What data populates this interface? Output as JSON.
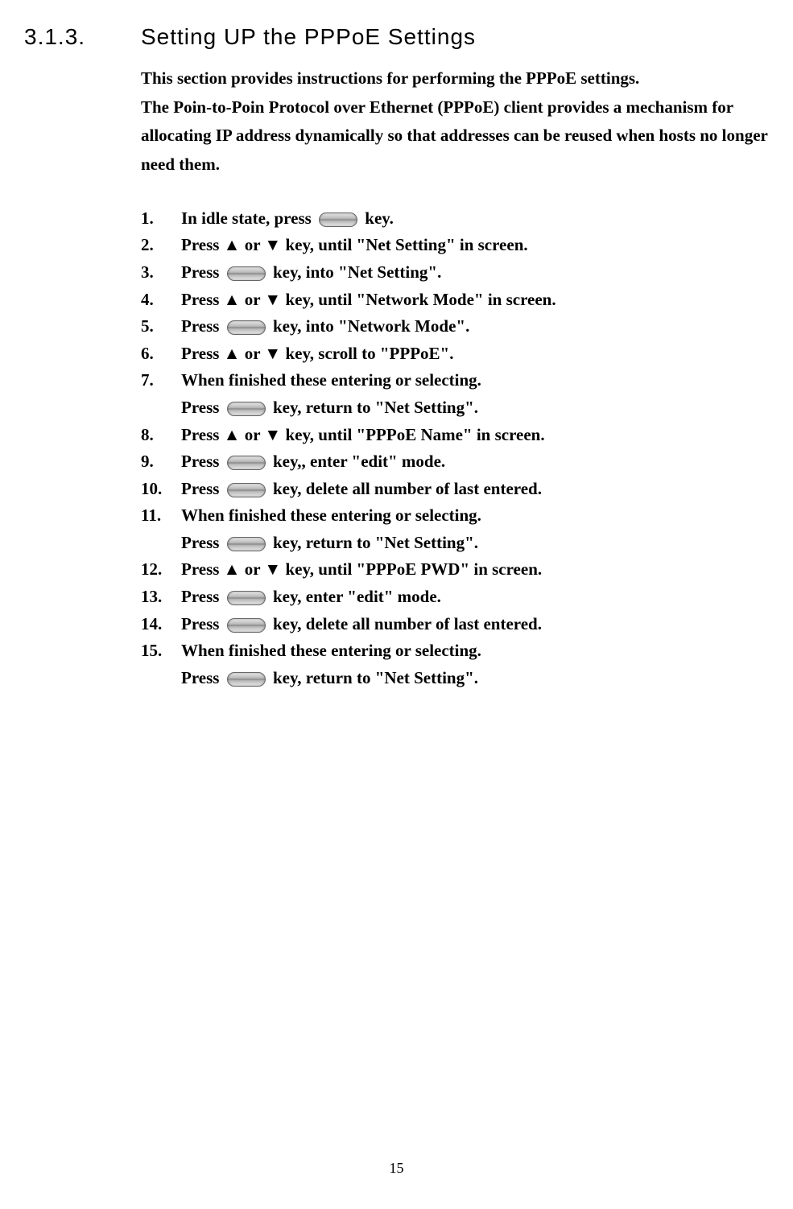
{
  "section": {
    "number": "3.1.3.",
    "title": "Setting UP the PPPoE Settings"
  },
  "intro": {
    "line1": "This section provides instructions for performing the PPPoE settings.",
    "line2": "The Poin-to-Poin Protocol over Ethernet (PPPoE) client provides a mechanism for allocating IP address dynamically so that addresses can be reused when hosts no longer need them."
  },
  "steps": [
    {
      "num": "1.",
      "before": "In idle state, press ",
      "icon": true,
      "after": " key."
    },
    {
      "num": "2.",
      "before": "Press ▲ or ▼ key, until \"Net Setting\" in screen.",
      "icon": false,
      "after": ""
    },
    {
      "num": "3.",
      "before": "Press ",
      "icon": true,
      "after": " key, into \"Net Setting\"."
    },
    {
      "num": "4.",
      "before": "Press ▲ or ▼ key, until \"Network Mode\" in screen.",
      "icon": false,
      "after": ""
    },
    {
      "num": "5.",
      "before": "Press ",
      "icon": true,
      "after": " key, into \"Network Mode\"."
    },
    {
      "num": "6.",
      "before": "Press ▲ or ▼ key, scroll to \"PPPoE\".",
      "icon": false,
      "after": ""
    },
    {
      "num": "7.",
      "before": "When finished these entering or selecting.",
      "icon": false,
      "after": "",
      "line2before": "Press ",
      "line2icon": true,
      "line2after": " key, return to \"Net Setting\"."
    },
    {
      "num": "8.",
      "before": "Press ▲ or ▼ key, until \"PPPoE Name\" in screen.",
      "icon": false,
      "after": ""
    },
    {
      "num": "9.",
      "before": "Press ",
      "icon": true,
      "after": " key,, enter \"edit\" mode."
    },
    {
      "num": "10.",
      "before": "Press ",
      "icon": true,
      "after": " key, delete all number of last entered."
    },
    {
      "num": "11.",
      "before": "When finished these entering or selecting.",
      "icon": false,
      "after": "",
      "line2before": "Press ",
      "line2icon": true,
      "line2after": " key, return to \"Net Setting\"."
    },
    {
      "num": "12.",
      "before": "Press ▲ or ▼ key, until \"PPPoE PWD\" in screen.",
      "icon": false,
      "after": ""
    },
    {
      "num": "13.",
      "before": "Press ",
      "icon": true,
      "after": " key, enter \"edit\" mode."
    },
    {
      "num": "14.",
      "before": "Press ",
      "icon": true,
      "after": " key, delete all number of last entered."
    },
    {
      "num": "15.",
      "before": "When finished these entering or selecting.",
      "icon": false,
      "after": "",
      "line2before": "Press ",
      "line2icon": true,
      "line2after": " key, return to \"Net Setting\"."
    }
  ],
  "pageNumber": "15"
}
